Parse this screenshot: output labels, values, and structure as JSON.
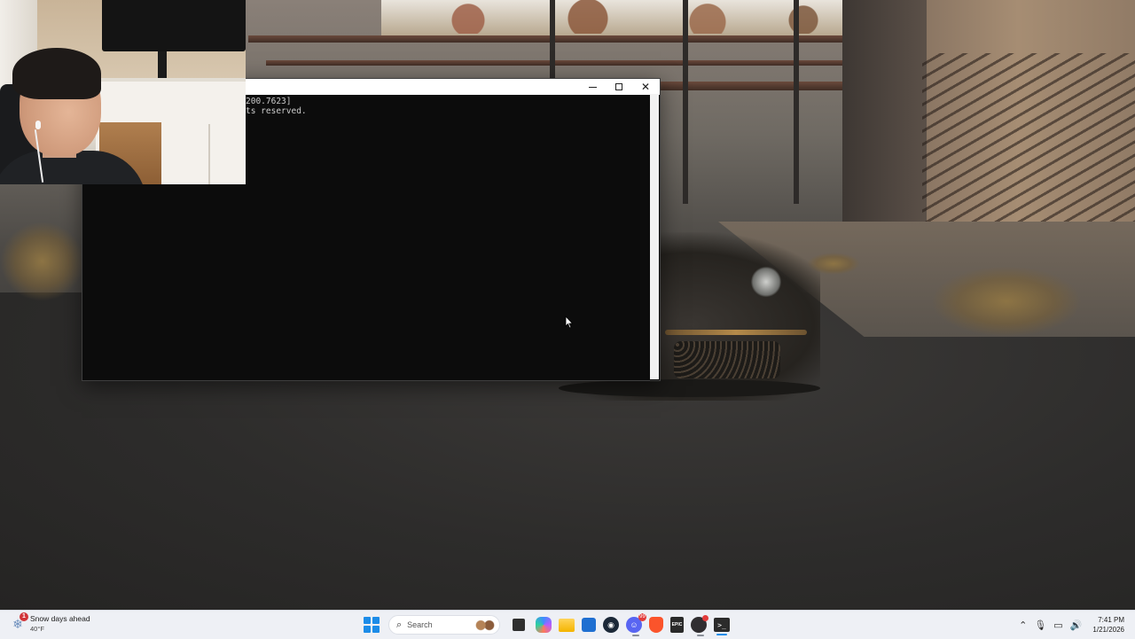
{
  "terminal": {
    "line1": "200.7623]",
    "line2": "ts reserved.",
    "controls": {
      "minimize": "minimize",
      "maximize": "maximize",
      "close": "close"
    }
  },
  "taskbar": {
    "weather": {
      "badge": "1",
      "title": "Snow days ahead",
      "temp": "40°F",
      "icon": "snowflake-icon"
    },
    "search": {
      "placeholder": "Search"
    },
    "pinned": [
      {
        "name": "task-view",
        "icon": "task-view-icon"
      },
      {
        "name": "copilot",
        "icon": "copilot-icon"
      },
      {
        "name": "file-explorer",
        "icon": "folder-icon"
      },
      {
        "name": "microsoft-store",
        "icon": "store-icon"
      },
      {
        "name": "steam",
        "icon": "steam-icon"
      },
      {
        "name": "discord",
        "icon": "discord-icon",
        "badge": "99"
      },
      {
        "name": "brave",
        "icon": "brave-icon"
      },
      {
        "name": "epic-games",
        "icon": "epic-games-icon",
        "label": "EPIC"
      },
      {
        "name": "obs",
        "icon": "obs-icon"
      },
      {
        "name": "terminal",
        "icon": "terminal-icon"
      }
    ],
    "tray": {
      "time": "7:41 PM",
      "date": "1/21/2026"
    }
  },
  "colors": {
    "accent": "#1c8ce8",
    "terminal_bg": "#0c0c0c",
    "taskbar_bg": "#eef0f5"
  }
}
